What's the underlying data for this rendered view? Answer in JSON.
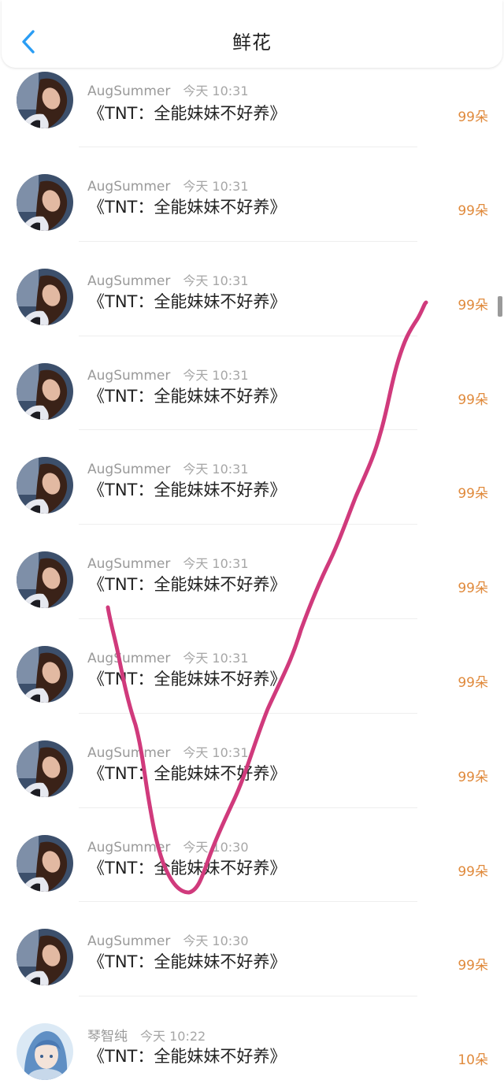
{
  "header": {
    "title": "鲜花"
  },
  "items": [
    {
      "user": "AugSummer",
      "time": "今天 10:31",
      "book": "《TNT：全能妹妹不好养》",
      "flowers": "99朵",
      "avatar": "girl-avatar"
    },
    {
      "user": "AugSummer",
      "time": "今天 10:31",
      "book": "《TNT：全能妹妹不好养》",
      "flowers": "99朵",
      "avatar": "girl-avatar"
    },
    {
      "user": "AugSummer",
      "time": "今天 10:31",
      "book": "《TNT：全能妹妹不好养》",
      "flowers": "99朵",
      "avatar": "girl-avatar"
    },
    {
      "user": "AugSummer",
      "time": "今天 10:31",
      "book": "《TNT：全能妹妹不好养》",
      "flowers": "99朵",
      "avatar": "girl-avatar"
    },
    {
      "user": "AugSummer",
      "time": "今天 10:31",
      "book": "《TNT：全能妹妹不好养》",
      "flowers": "99朵",
      "avatar": "girl-avatar"
    },
    {
      "user": "AugSummer",
      "time": "今天 10:31",
      "book": "《TNT：全能妹妹不好养》",
      "flowers": "99朵",
      "avatar": "girl-avatar"
    },
    {
      "user": "AugSummer",
      "time": "今天 10:31",
      "book": "《TNT：全能妹妹不好养》",
      "flowers": "99朵",
      "avatar": "girl-avatar"
    },
    {
      "user": "AugSummer",
      "time": "今天 10:31",
      "book": "《TNT：全能妹妹不好养》",
      "flowers": "99朵",
      "avatar": "girl-avatar"
    },
    {
      "user": "AugSummer",
      "time": "今天 10:30",
      "book": "《TNT：全能妹妹不好养》",
      "flowers": "99朵",
      "avatar": "girl-avatar"
    },
    {
      "user": "AugSummer",
      "time": "今天 10:30",
      "book": "《TNT：全能妹妹不好养》",
      "flowers": "99朵",
      "avatar": "girl-avatar"
    },
    {
      "user": "琴智纯",
      "time": "今天 10:22",
      "book": "《TNT：全能妹妹不好养》",
      "flowers": "10朵",
      "avatar": "anime-avatar"
    }
  ],
  "colors": {
    "accent": "#2a9df4",
    "flowers": "#e08a3c",
    "annotation": "#d03a7c"
  }
}
